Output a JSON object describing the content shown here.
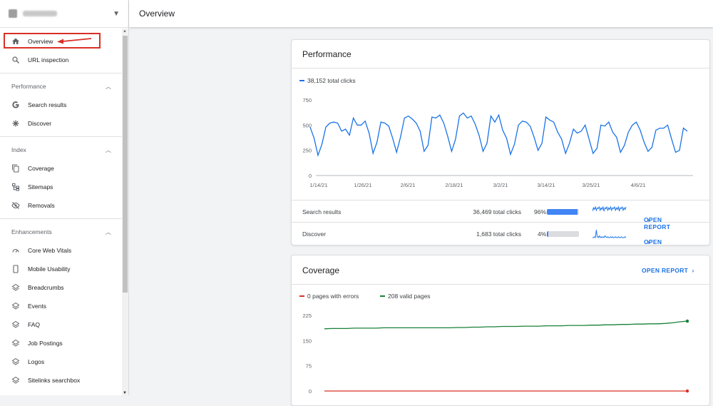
{
  "header": {
    "title": "Overview"
  },
  "sidebar": {
    "top_items": [
      {
        "label": "Overview",
        "icon": "home-icon"
      },
      {
        "label": "URL inspection",
        "icon": "search-icon"
      }
    ],
    "sections": [
      {
        "title": "Performance",
        "items": [
          {
            "label": "Search results",
            "icon": "google-g-icon"
          },
          {
            "label": "Discover",
            "icon": "asterisk-icon"
          }
        ]
      },
      {
        "title": "Index",
        "items": [
          {
            "label": "Coverage",
            "icon": "file-copy-icon"
          },
          {
            "label": "Sitemaps",
            "icon": "sitemap-icon"
          },
          {
            "label": "Removals",
            "icon": "eye-off-icon"
          }
        ]
      },
      {
        "title": "Enhancements",
        "items": [
          {
            "label": "Core Web Vitals",
            "icon": "speedometer-icon"
          },
          {
            "label": "Mobile Usability",
            "icon": "phone-icon"
          },
          {
            "label": "Breadcrumbs",
            "icon": "layers-icon"
          },
          {
            "label": "Events",
            "icon": "layers-icon"
          },
          {
            "label": "FAQ",
            "icon": "layers-icon"
          },
          {
            "label": "Job Postings",
            "icon": "layers-icon"
          },
          {
            "label": "Logos",
            "icon": "layers-icon"
          },
          {
            "label": "Sitelinks searchbox",
            "icon": "layers-icon"
          }
        ]
      }
    ]
  },
  "performance": {
    "title": "Performance",
    "legend": "38,152 total clicks",
    "color": "#1a73e8",
    "rows": [
      {
        "name": "Search results",
        "clicks": "36,469 total clicks",
        "percent": "96%",
        "fraction": 0.96,
        "action": "OPEN REPORT"
      },
      {
        "name": "Discover",
        "clicks": "1,683 total clicks",
        "percent": "4%",
        "fraction": 0.04,
        "action": "OPEN REPORT"
      }
    ]
  },
  "coverage": {
    "title": "Coverage",
    "action": "OPEN REPORT",
    "legend_errors": "0 pages with errors",
    "legend_valid": "208 valid pages",
    "error_color": "#d93025",
    "valid_color": "#188038"
  },
  "chart_data": [
    {
      "type": "line",
      "x_tick_labels": [
        "1/14/21",
        "1/26/21",
        "2/6/21",
        "2/18/21",
        "3/2/21",
        "3/14/21",
        "3/25/21",
        "4/6/21"
      ],
      "y_ticks": [
        0,
        250,
        500,
        750
      ],
      "ylim": [
        0,
        750
      ],
      "series": [
        {
          "name": "38,152 total clicks",
          "values": [
            480,
            370,
            200,
            310,
            480,
            520,
            530,
            520,
            440,
            460,
            400,
            570,
            500,
            500,
            540,
            420,
            220,
            330,
            530,
            520,
            490,
            370,
            230,
            380,
            570,
            590,
            560,
            520,
            440,
            240,
            300,
            580,
            570,
            600,
            520,
            390,
            240,
            360,
            590,
            620,
            570,
            590,
            510,
            400,
            240,
            320,
            590,
            530,
            600,
            450,
            370,
            210,
            310,
            500,
            540,
            530,
            490,
            380,
            250,
            320,
            580,
            550,
            530,
            430,
            360,
            220,
            320,
            460,
            420,
            440,
            500,
            360,
            220,
            270,
            500,
            490,
            530,
            430,
            380,
            230,
            300,
            430,
            500,
            530,
            450,
            330,
            240,
            280,
            450,
            470,
            470,
            500,
            360,
            230,
            250,
            470,
            440
          ]
        }
      ]
    },
    {
      "type": "line",
      "y_ticks": [
        0,
        75,
        150,
        225
      ],
      "ylim": [
        0,
        225
      ],
      "series": [
        {
          "name": "0 pages with errors",
          "values": [
            0,
            0,
            0,
            0,
            0,
            0,
            0,
            0,
            0,
            0,
            0,
            0,
            0,
            0,
            0,
            0,
            0,
            0,
            0,
            0,
            0,
            0,
            0,
            0,
            0,
            0,
            0,
            0,
            0,
            0,
            0,
            0,
            0,
            0,
            0,
            0,
            0,
            0,
            0,
            0,
            0,
            0,
            0,
            0,
            0,
            0,
            0,
            0,
            0,
            0
          ]
        },
        {
          "name": "208 valid pages",
          "values": [
            185,
            186,
            186,
            186,
            187,
            187,
            187,
            187,
            188,
            188,
            188,
            188,
            188,
            188,
            188,
            188,
            188,
            188,
            189,
            189,
            190,
            190,
            191,
            191,
            192,
            192,
            192,
            193,
            193,
            193,
            194,
            194,
            194,
            195,
            195,
            195,
            196,
            196,
            197,
            197,
            198,
            198,
            199,
            199,
            200,
            200,
            201,
            203,
            206,
            208
          ]
        }
      ]
    },
    {
      "type": "line",
      "series": [
        {
          "name": "Search results",
          "values": [
            5,
            9,
            7,
            10,
            6,
            9,
            8,
            10,
            6,
            9,
            7,
            10,
            5,
            9,
            8,
            10,
            6,
            9,
            7,
            10,
            6,
            9,
            8,
            10,
            6,
            9,
            7,
            10,
            5,
            9,
            8,
            10,
            6,
            9,
            7,
            10
          ]
        },
        {
          "name": "Discover",
          "values": [
            0,
            0,
            1,
            0,
            9,
            1,
            0,
            2,
            0,
            1,
            0,
            1,
            0,
            2,
            1,
            0,
            1,
            0,
            0,
            1,
            0,
            1,
            0,
            0,
            1,
            0,
            0,
            1,
            0,
            0,
            1,
            0,
            0,
            0,
            1,
            0
          ]
        }
      ]
    }
  ]
}
